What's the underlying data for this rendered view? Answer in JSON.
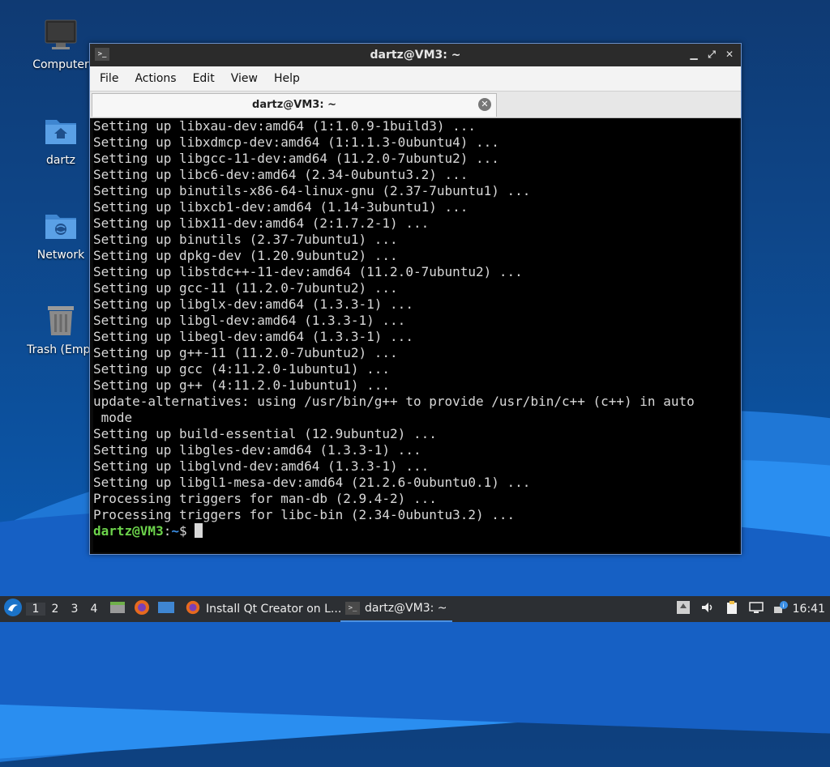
{
  "desktop": {
    "icons": [
      {
        "label": "Computer"
      },
      {
        "label": "dartz"
      },
      {
        "label": "Network"
      },
      {
        "label": "Trash (Empt"
      }
    ]
  },
  "window": {
    "title": "dartz@VM3: ~",
    "controls": {
      "minimize": "▁",
      "maximize": "⤢",
      "close": "✕"
    },
    "menu": [
      "File",
      "Actions",
      "Edit",
      "View",
      "Help"
    ],
    "tab": {
      "label": "dartz@VM3: ~",
      "close": "✕"
    },
    "terminal_lines": [
      "Setting up libxau-dev:amd64 (1:1.0.9-1build3) ...",
      "Setting up libxdmcp-dev:amd64 (1:1.1.3-0ubuntu4) ...",
      "Setting up libgcc-11-dev:amd64 (11.2.0-7ubuntu2) ...",
      "Setting up libc6-dev:amd64 (2.34-0ubuntu3.2) ...",
      "Setting up binutils-x86-64-linux-gnu (2.37-7ubuntu1) ...",
      "Setting up libxcb1-dev:amd64 (1.14-3ubuntu1) ...",
      "Setting up libx11-dev:amd64 (2:1.7.2-1) ...",
      "Setting up binutils (2.37-7ubuntu1) ...",
      "Setting up dpkg-dev (1.20.9ubuntu2) ...",
      "Setting up libstdc++-11-dev:amd64 (11.2.0-7ubuntu2) ...",
      "Setting up gcc-11 (11.2.0-7ubuntu2) ...",
      "Setting up libglx-dev:amd64 (1.3.3-1) ...",
      "Setting up libgl-dev:amd64 (1.3.3-1) ...",
      "Setting up libegl-dev:amd64 (1.3.3-1) ...",
      "Setting up g++-11 (11.2.0-7ubuntu2) ...",
      "Setting up gcc (4:11.2.0-1ubuntu1) ...",
      "Setting up g++ (4:11.2.0-1ubuntu1) ...",
      "update-alternatives: using /usr/bin/g++ to provide /usr/bin/c++ (c++) in auto",
      " mode",
      "Setting up build-essential (12.9ubuntu2) ...",
      "Setting up libgles-dev:amd64 (1.3.3-1) ...",
      "Setting up libglvnd-dev:amd64 (1.3.3-1) ...",
      "Setting up libgl1-mesa-dev:amd64 (21.2.6-0ubuntu0.1) ...",
      "Processing triggers for man-db (2.9.4-2) ...",
      "Processing triggers for libc-bin (2.34-0ubuntu3.2) ..."
    ],
    "prompt": {
      "user": "dartz@VM3",
      "sep": ":",
      "path": "~",
      "symbol": "$ "
    }
  },
  "taskbar": {
    "workspaces": [
      "1",
      "2",
      "3",
      "4"
    ],
    "tasks": [
      {
        "label": "Install Qt Creator on L..."
      },
      {
        "label": "dartz@VM3: ~"
      }
    ],
    "clock": "16:41"
  },
  "colors": {
    "prompt_user": "#6cd34b",
    "prompt_path": "#3b8fe6",
    "accent": "#4a90e2"
  }
}
